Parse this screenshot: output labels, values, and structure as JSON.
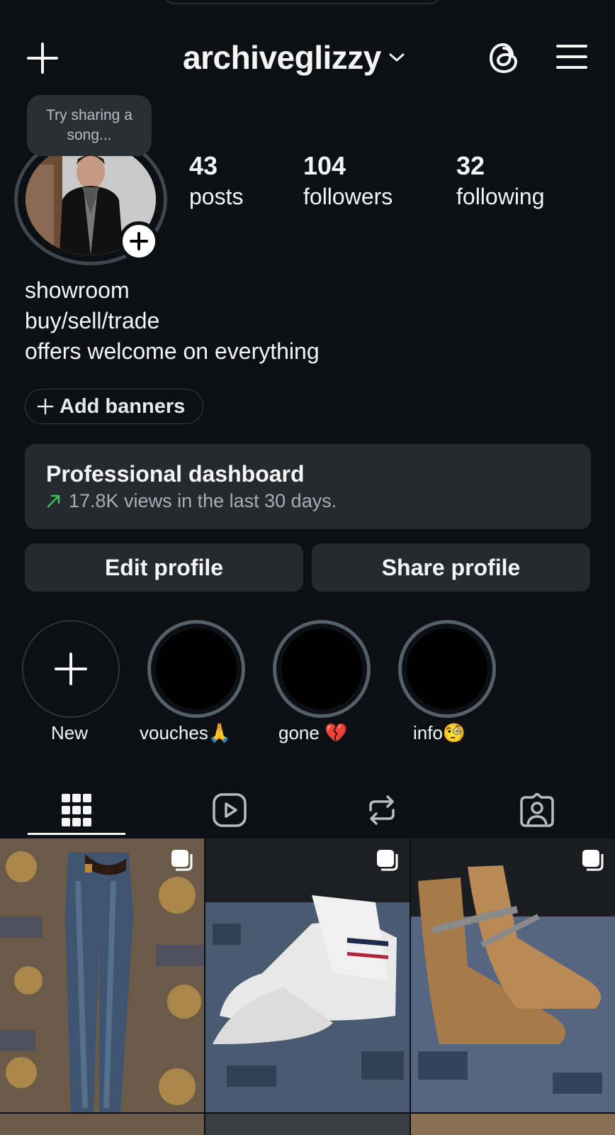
{
  "header": {
    "username": "archiveglizzy",
    "icons": [
      "plus-icon",
      "chevron-down-icon",
      "threads-icon",
      "hamburger-menu-icon"
    ]
  },
  "profile": {
    "note_text": "Try sharing a song...",
    "stats": [
      {
        "value": "43",
        "label": "posts"
      },
      {
        "value": "104",
        "label": "followers"
      },
      {
        "value": "32",
        "label": "following"
      }
    ],
    "bio": [
      "showroom",
      "buy/sell/trade",
      "offers welcome on everything"
    ],
    "add_banners_label": "Add banners"
  },
  "dashboard": {
    "title": "Professional dashboard",
    "subtitle": "17.8K views in the last 30 days.",
    "trend_color": "#3ec15a"
  },
  "buttons": {
    "edit": "Edit profile",
    "share": "Share profile"
  },
  "highlights": [
    {
      "label": "New",
      "type": "new"
    },
    {
      "label": "vouches🙏",
      "type": "story"
    },
    {
      "label": "gone 💔",
      "type": "story"
    },
    {
      "label": "info🧐",
      "type": "story"
    }
  ],
  "tabs": [
    "grid-icon",
    "reels-icon",
    "reposts-icon",
    "tagged-icon"
  ],
  "grid": [
    {
      "name": "post-jeans",
      "carousel": true
    },
    {
      "name": "post-sneakers",
      "carousel": true
    },
    {
      "name": "post-boots",
      "carousel": true
    }
  ]
}
